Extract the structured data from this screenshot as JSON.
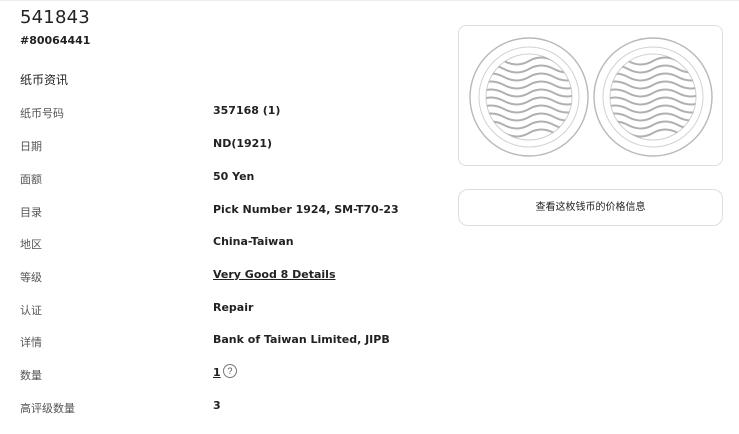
{
  "header": {
    "title": "541843",
    "cert_number": "#80064441"
  },
  "section_title": "纸币资讯",
  "details": [
    {
      "label": "纸币号码",
      "value": "357168 (1)"
    },
    {
      "label": "日期",
      "value": "ND(1921)"
    },
    {
      "label": "面额",
      "value": "50 Yen"
    },
    {
      "label": "目录",
      "value": "Pick Number 1924, SM-T70-23"
    },
    {
      "label": "地区",
      "value": "China-Taiwan"
    },
    {
      "label": "等级",
      "value": "Very Good 8 Details"
    },
    {
      "label": "认证",
      "value": "Repair"
    },
    {
      "label": "详情",
      "value": "Bank of Taiwan Limited, JIPB"
    },
    {
      "label": "数量",
      "value": "1"
    },
    {
      "label": "高评级数量",
      "value": "3"
    }
  ],
  "help_icon": "question-circle-icon",
  "help_glyph": "?",
  "image_placeholder_icons": [
    "coin-front-placeholder-icon",
    "coin-back-placeholder-icon"
  ],
  "price_button_label": "查看这枚钱币的价格信息",
  "colors": {
    "text": "#222222",
    "label": "#555555",
    "border": "#dedede",
    "placeholder_stroke": "#b5b5b5"
  }
}
